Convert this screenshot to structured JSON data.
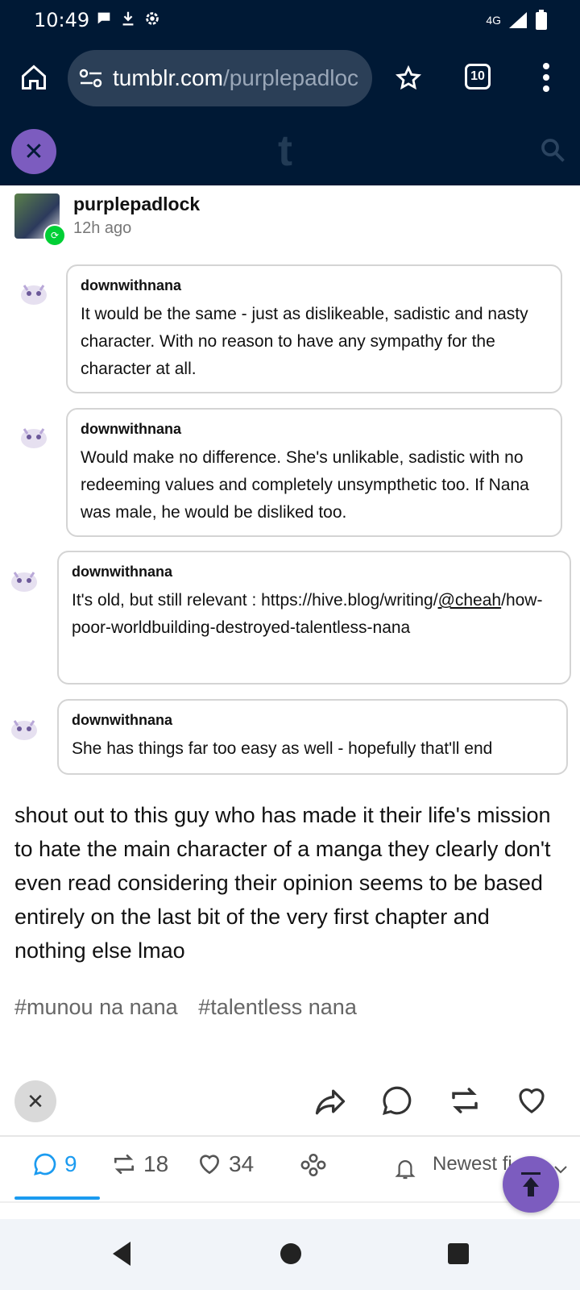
{
  "status_bar": {
    "time": "10:49",
    "network": "4G"
  },
  "browser": {
    "url_host": "tumblr.com",
    "url_path": "/purplepadloc",
    "tab_count": "10"
  },
  "tumblr": {
    "logo": "t"
  },
  "post": {
    "author": "purplepadlock",
    "time_ago": "12h ago",
    "replies": [
      {
        "user": "downwithnana",
        "text": "It would be the same - just as dislikeable, sadistic and nasty character.  With no reason to have any sympathy for the character at all."
      },
      {
        "user": "downwithnana",
        "text": "Would make no difference.  She's unlikable, sadistic with no redeeming values and completely unsympthetic too.  If Nana was male, he would be disliked too."
      },
      {
        "user": "downwithnana",
        "text_before": "It's old, but still relevant : https://hive.blog/writing/",
        "mention": "@cheah",
        "text_after": "/how-poor-worldbuilding-destroyed-talentless-nana"
      },
      {
        "user": "downwithnana",
        "text": "She has things far too easy as well - hopefully that'll end"
      }
    ],
    "caption": "shout out to this guy who has made it their life's mission to hate the main character of a manga they clearly don't even read considering their opinion seems to be based entirely on the last bit of the very first chapter and nothing else lmao",
    "tags": [
      "#munou na nana",
      "#talentless nana"
    ]
  },
  "counts": {
    "replies": "9",
    "reblogs": "18",
    "likes": "34"
  },
  "sort": {
    "label": "Newest fi"
  }
}
